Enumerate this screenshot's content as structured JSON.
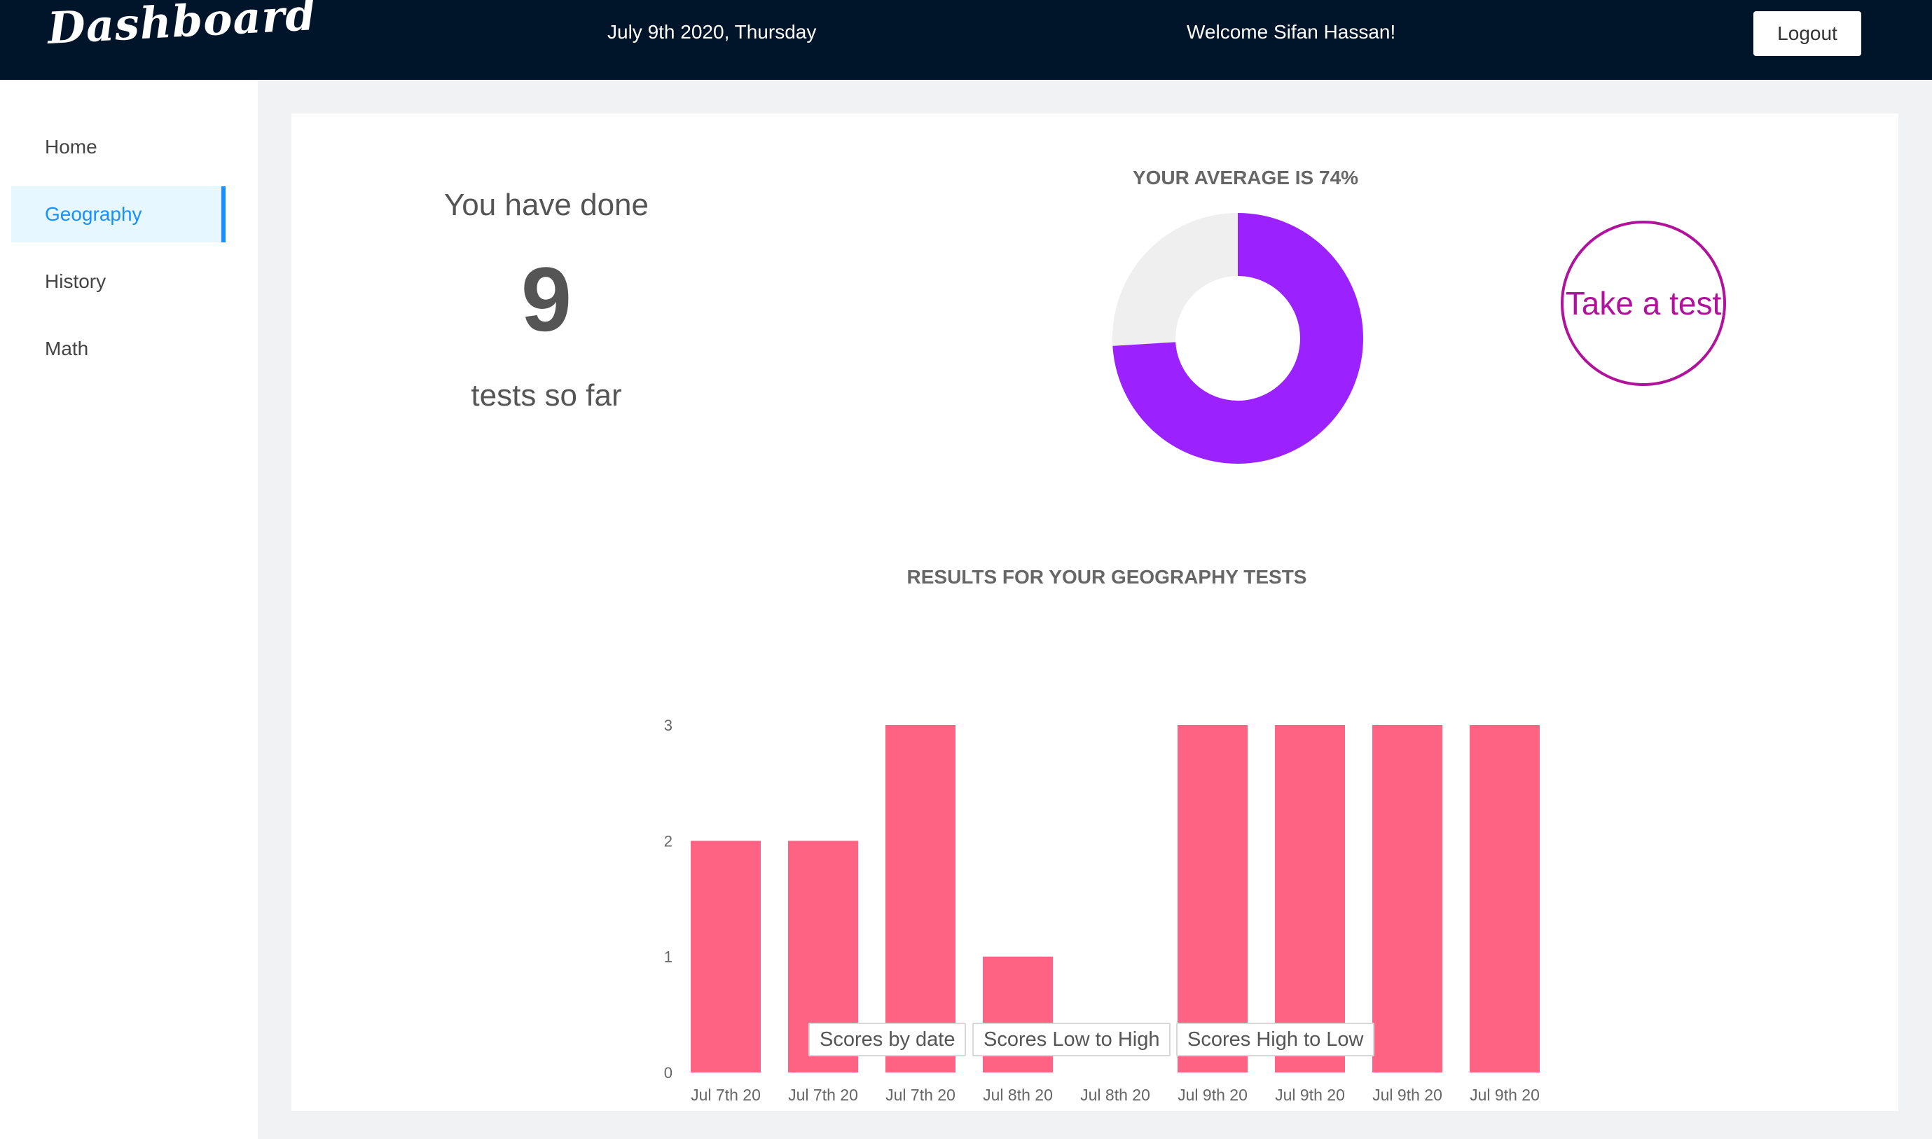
{
  "header": {
    "logo": "Dashboard",
    "date": "July 9th 2020, Thursday",
    "welcome": "Welcome Sifan Hassan!",
    "logout_label": "Logout",
    "background": "#01152a"
  },
  "sidebar": {
    "items": [
      {
        "label": "Home",
        "active": false
      },
      {
        "label": "Geography",
        "active": true
      },
      {
        "label": "History",
        "active": false
      },
      {
        "label": "Math",
        "active": false
      }
    ],
    "active_color": "#1890ff"
  },
  "summary": {
    "line1": "You have done",
    "count": "9",
    "line2": "tests so far"
  },
  "average": {
    "title": "YOUR AVERAGE IS 74%",
    "percent": 74,
    "fill_color": "#9b22ff",
    "rest_color": "#efefef"
  },
  "take_test": {
    "label": "Take a test",
    "color": "#b0129b"
  },
  "chart_data": {
    "type": "bar",
    "title": "RESULTS FOR YOUR GEOGRAPHY TESTS",
    "categories": [
      "Jul 7th 20",
      "Jul 7th 20",
      "Jul 7th 20",
      "Jul 8th 20",
      "Jul 8th 20",
      "Jul 9th 20",
      "Jul 9th 20",
      "Jul 9th 20",
      "Jul 9th 20"
    ],
    "values": [
      2,
      2,
      3,
      1,
      0,
      3,
      3,
      3,
      3
    ],
    "yticks": [
      "0",
      "1",
      "2",
      "3"
    ],
    "ylim": [
      0,
      3
    ],
    "xlabel": "",
    "ylabel": "",
    "grid": false,
    "bar_color": "#ff6384"
  },
  "sort_buttons": {
    "by_date": "Scores by date",
    "low_high": "Scores Low to High",
    "high_low": "Scores High to Low"
  }
}
